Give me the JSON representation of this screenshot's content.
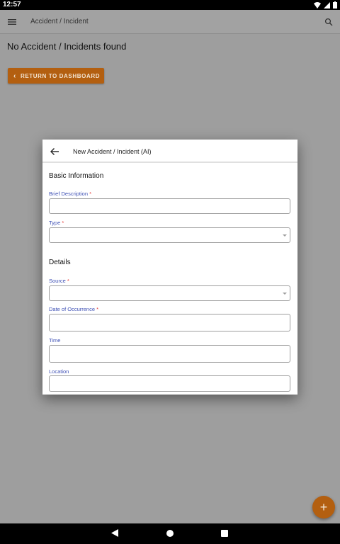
{
  "status_bar": {
    "time": "12:57"
  },
  "app_bar": {
    "title": "Accident / Incident"
  },
  "page": {
    "heading": "No Accident / Incidents found",
    "return_button_label": "RETURN TO DASHBOARD"
  },
  "dialog": {
    "title": "New Accident / Incident (AI)",
    "sections": {
      "basic": "Basic Information",
      "details": "Details"
    },
    "fields": {
      "brief_description": {
        "label": "Brief Description",
        "required": "*",
        "value": ""
      },
      "type": {
        "label": "Type",
        "required": "*",
        "value": ""
      },
      "source": {
        "label": "Source",
        "required": "*",
        "value": ""
      },
      "date_of_occurrence": {
        "label": "Date of Occurrence",
        "required": "*",
        "value": ""
      },
      "time": {
        "label": "Time",
        "value": ""
      },
      "location": {
        "label": "Location",
        "value": ""
      }
    }
  },
  "fab": {
    "label": "+"
  },
  "colors": {
    "accent": "#b35f10",
    "label_blue": "#3f51b5",
    "required_red": "#e53935"
  },
  "icons": [
    "menu-icon",
    "search-icon",
    "back-arrow-icon",
    "chevron-left-icon",
    "plus-icon",
    "wifi-icon",
    "signal-icon",
    "battery-icon"
  ]
}
